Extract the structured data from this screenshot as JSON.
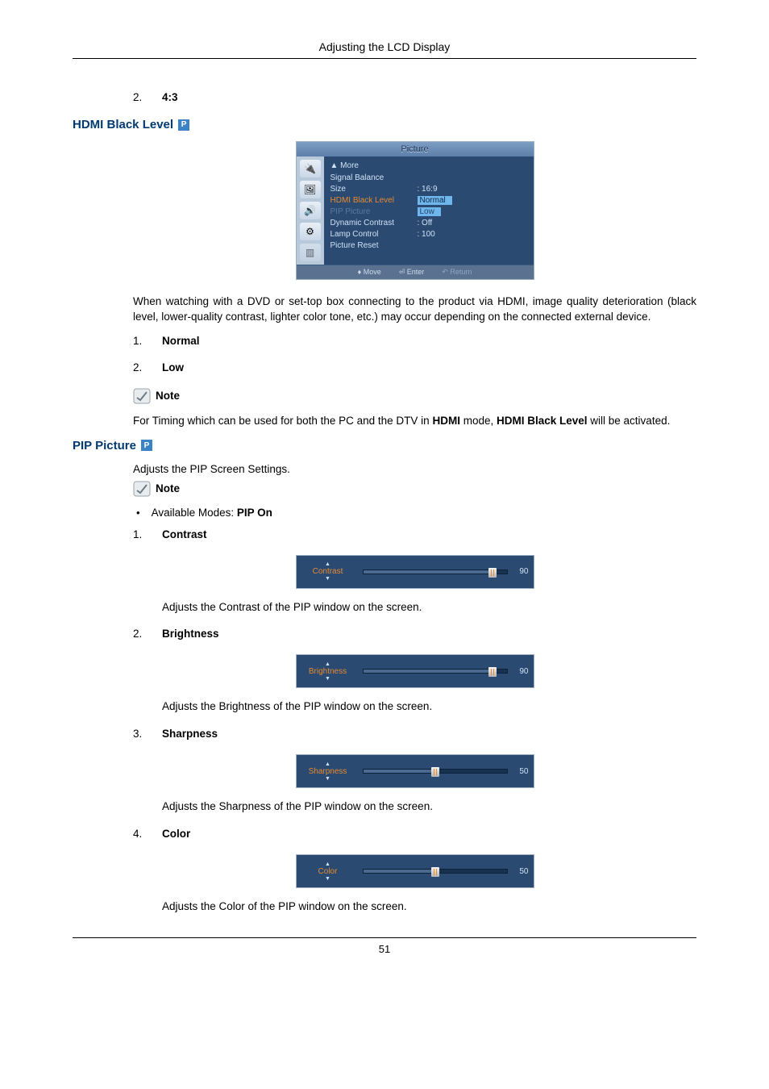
{
  "header": {
    "title": "Adjusting the LCD Display"
  },
  "intro_item": {
    "num": "2.",
    "label": "4:3"
  },
  "hdmi": {
    "heading": "HDMI Black Level",
    "osd": {
      "title": "Picture",
      "more": "▲ More",
      "rows": [
        {
          "label": "Signal Balance",
          "value": ""
        },
        {
          "label": "Size",
          "value": ": 16:9"
        },
        {
          "label": "HDMI Black Level",
          "value": "Normal",
          "next": "Low",
          "sel": true
        },
        {
          "label": "PIP Picture",
          "value": "",
          "dim": true
        },
        {
          "label": "Dynamic Contrast",
          "value": ": Off"
        },
        {
          "label": "Lamp Control",
          "value": ": 100"
        },
        {
          "label": "Picture Reset",
          "value": ""
        }
      ],
      "footer": {
        "move": "Move",
        "enter": "Enter",
        "ret": "Return"
      }
    },
    "para": "When watching with a DVD or set-top box connecting to the product via HDMI, image quality deterioration (black level, lower-quality contrast, lighter color tone, etc.) may occur depending on the connected external device.",
    "items": [
      {
        "num": "1.",
        "label": "Normal"
      },
      {
        "num": "2.",
        "label": "Low"
      }
    ],
    "note_label": "Note",
    "note_text_pre": "For Timing which can be used for both the PC and the DTV in ",
    "note_bold1": "HDMI",
    "note_mid": " mode, ",
    "note_bold2": "HDMI Black Level",
    "note_text_post": " will be activated."
  },
  "pip": {
    "heading": "PIP Picture",
    "intro": "Adjusts the PIP Screen Settings.",
    "note_label": "Note",
    "modes_pre": "Available Modes: ",
    "modes_bold": "PIP On",
    "items": [
      {
        "num": "1.",
        "label": "Contrast",
        "slider": "Contrast",
        "value": "90",
        "percent": 90,
        "desc": "Adjusts the Contrast of the PIP window on the screen."
      },
      {
        "num": "2.",
        "label": "Brightness",
        "slider": "Brightness",
        "value": "90",
        "percent": 90,
        "desc": "Adjusts the Brightness of the PIP window on the screen."
      },
      {
        "num": "3.",
        "label": "Sharpness",
        "slider": "Sharpness",
        "value": "50",
        "percent": 50,
        "desc": "Adjusts the Sharpness of the PIP window on the screen."
      },
      {
        "num": "4.",
        "label": "Color",
        "slider": "Color",
        "value": "50",
        "percent": 50,
        "desc": "Adjusts the Color of the PIP window on the screen."
      }
    ]
  },
  "footer": {
    "page": "51"
  }
}
